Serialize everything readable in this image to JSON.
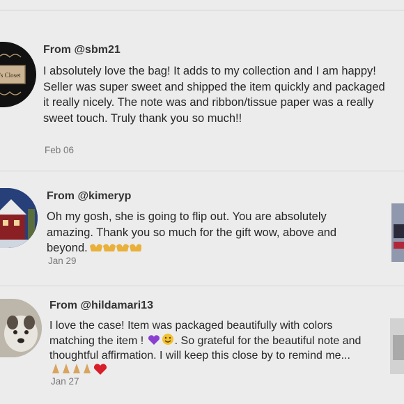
{
  "reviews": [
    {
      "from": "From @sbm21",
      "text": "I absolutely love the bag! It adds to my collection and I am happy! Seller was super sweet and shipped the item quickly and packaged it really nicely. The note was and ribbon/tissue paper was a really sweet touch. Truly thank you so much!!",
      "date": "Feb 06",
      "avatar_text": "’s Closet"
    },
    {
      "from": "From @kimeryp",
      "text": "Oh my gosh, she is going to flip out. You are absolutely amazing. Thank you so much for the gift wow, above and beyond.",
      "date": "Jan 29"
    },
    {
      "from": "From @hildamari13",
      "text_a": "I love the case! Item was packaged beautifully with colors matching the item !",
      "text_b": ". So grateful for the beautiful note and thoughtful affirmation. I will keep this close by to remind me...",
      "date": "Jan 27"
    }
  ],
  "icons": [
    "heart-hands-icon",
    "purple-heart-icon",
    "smile-icon",
    "praying-hands-icon",
    "red-heart-icon"
  ],
  "colors": {
    "background": "#ececec",
    "text": "#262626",
    "date": "#777777"
  }
}
